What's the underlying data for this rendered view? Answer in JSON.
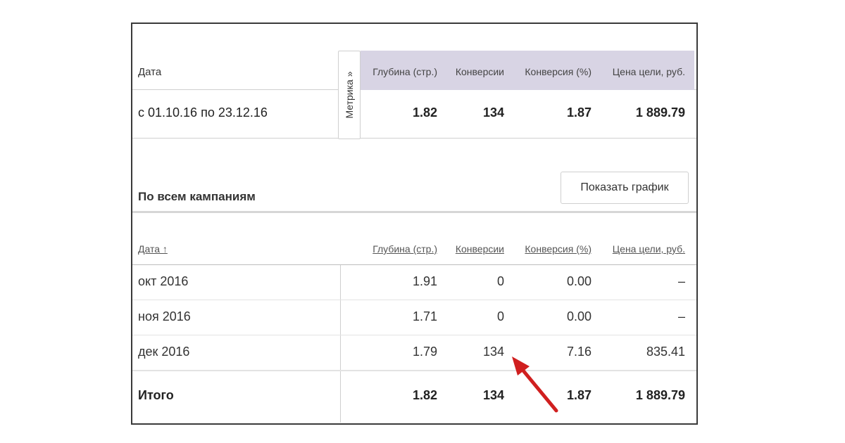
{
  "summary": {
    "date_label": "Дата",
    "metrika_tab": "Метрика »",
    "columns": [
      "Глубина (стр.)",
      "Конверсии",
      "Конверсия (%)",
      "Цена цели, руб."
    ],
    "period": "с 01.10.16 по 23.12.16",
    "values": [
      "1.82",
      "134",
      "1.87",
      "1 889.79"
    ]
  },
  "section": {
    "title": "По всем кампаниям",
    "show_chart_label": "Показать график"
  },
  "table": {
    "date_header": "Дата ↑",
    "columns": [
      "Глубина (стр.)",
      "Конверсии",
      "Конверсия (%)",
      "Цена цели, руб."
    ],
    "rows": [
      {
        "label": "окт 2016",
        "values": [
          "1.91",
          "0",
          "0.00",
          "–"
        ]
      },
      {
        "label": "ноя 2016",
        "values": [
          "1.71",
          "0",
          "0.00",
          "–"
        ]
      },
      {
        "label": "дек 2016",
        "values": [
          "1.79",
          "134",
          "7.16",
          "835.41"
        ]
      }
    ],
    "total": {
      "label": "Итого",
      "values": [
        "1.82",
        "134",
        "1.87",
        "1 889.79"
      ]
    }
  },
  "colors": {
    "header_band": "#d8d4e4",
    "arrow": "#d01f1f"
  }
}
